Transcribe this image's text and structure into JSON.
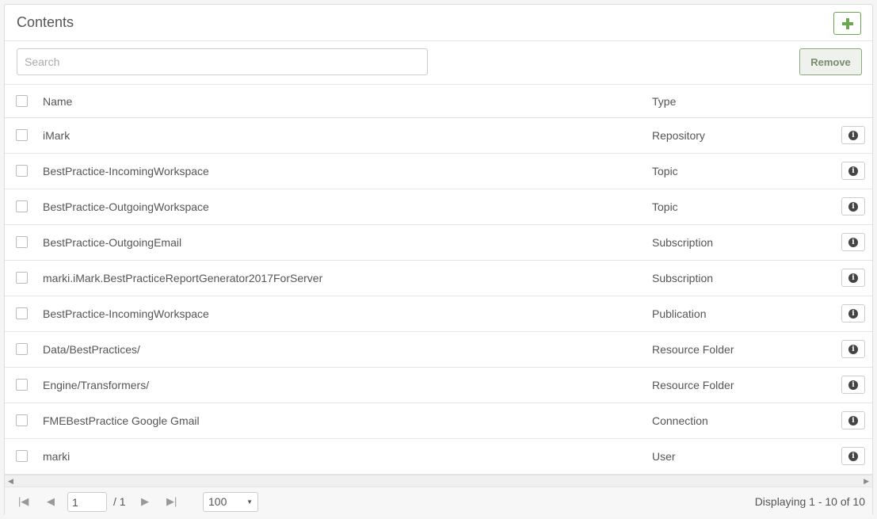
{
  "header": {
    "title": "Contents"
  },
  "toolbar": {
    "search_placeholder": "Search",
    "remove_label": "Remove"
  },
  "columns": {
    "name": "Name",
    "type": "Type"
  },
  "rows": [
    {
      "name": "iMark",
      "type": "Repository"
    },
    {
      "name": "BestPractice-IncomingWorkspace",
      "type": "Topic"
    },
    {
      "name": "BestPractice-OutgoingWorkspace",
      "type": "Topic"
    },
    {
      "name": "BestPractice-OutgoingEmail",
      "type": "Subscription"
    },
    {
      "name": "marki.iMark.BestPracticeReportGenerator2017ForServer",
      "type": "Subscription"
    },
    {
      "name": "BestPractice-IncomingWorkspace",
      "type": "Publication"
    },
    {
      "name": "Data/BestPractices/",
      "type": "Resource Folder"
    },
    {
      "name": "Engine/Transformers/",
      "type": "Resource Folder"
    },
    {
      "name": "FMEBestPractice Google Gmail",
      "type": "Connection"
    },
    {
      "name": "marki",
      "type": "User"
    }
  ],
  "pager": {
    "current_page": "1",
    "total_pages": "/ 1",
    "page_size": "100",
    "display_text": "Displaying 1 - 10 of 10"
  },
  "colors": {
    "accent_green": "#6aa84f",
    "border": "#dddddd"
  }
}
